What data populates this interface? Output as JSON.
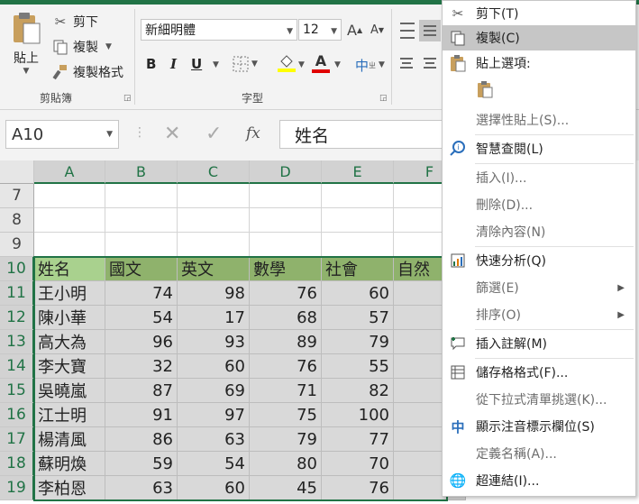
{
  "ribbon": {
    "clipboard_group": "剪貼簿",
    "font_group": "字型",
    "paste_label": "貼上",
    "cut_label": "剪下",
    "copy_label": "複製",
    "format_painter_label": "複製格式",
    "font_name": "新細明體",
    "font_size": "12",
    "bold": "B",
    "italic": "I",
    "underline": "U",
    "phonetic": "中",
    "increase_font": "A",
    "decrease_font": "A",
    "font_color": "A",
    "accent_color": "#217346"
  },
  "formula_bar": {
    "name_box": "A10",
    "fx": "fx",
    "content": "姓名"
  },
  "sheet": {
    "columns": [
      "A",
      "B",
      "C",
      "D",
      "E",
      "F"
    ],
    "rows": [
      {
        "num": "7",
        "cells": [
          "",
          "",
          "",
          "",
          "",
          ""
        ]
      },
      {
        "num": "8",
        "cells": [
          "",
          "",
          "",
          "",
          "",
          ""
        ]
      },
      {
        "num": "9",
        "cells": [
          "",
          "",
          "",
          "",
          "",
          ""
        ]
      },
      {
        "num": "10",
        "cells": [
          "姓名",
          "國文",
          "英文",
          "數學",
          "社會",
          "自然"
        ]
      },
      {
        "num": "11",
        "cells": [
          "王小明",
          "74",
          "98",
          "76",
          "60",
          ""
        ]
      },
      {
        "num": "12",
        "cells": [
          "陳小華",
          "54",
          "17",
          "68",
          "57",
          ""
        ]
      },
      {
        "num": "13",
        "cells": [
          "高大為",
          "96",
          "93",
          "89",
          "79",
          ""
        ]
      },
      {
        "num": "14",
        "cells": [
          "李大寶",
          "32",
          "60",
          "76",
          "55",
          ""
        ]
      },
      {
        "num": "15",
        "cells": [
          "吳曉嵐",
          "87",
          "69",
          "71",
          "82",
          ""
        ]
      },
      {
        "num": "16",
        "cells": [
          "江士明",
          "91",
          "97",
          "75",
          "100",
          ""
        ]
      },
      {
        "num": "17",
        "cells": [
          "楊清風",
          "86",
          "63",
          "79",
          "77",
          ""
        ]
      },
      {
        "num": "18",
        "cells": [
          "蘇明煥",
          "59",
          "54",
          "80",
          "70",
          ""
        ]
      },
      {
        "num": "19",
        "cells": [
          "李柏恩",
          "63",
          "60",
          "45",
          "76",
          ""
        ]
      }
    ],
    "header_fill": "#8fb26c",
    "active_fill": "#a9d18e",
    "selection_fill": "#d9d9d9"
  },
  "context_menu": {
    "items": [
      {
        "label": "剪下(T)",
        "icon": "scissors-icon"
      },
      {
        "label": "複製(C)",
        "icon": "copy-icon",
        "highlight": true
      },
      {
        "label": "貼上選項:",
        "icon": "paste-icon",
        "bold": true
      },
      {
        "label": "",
        "icon": "paste-icon"
      },
      {
        "label": "選擇性貼上(S)...",
        "icon": ""
      },
      {
        "label": "智慧查閱(L)",
        "icon": "search-info-icon"
      },
      {
        "label": "插入(I)...",
        "icon": ""
      },
      {
        "label": "刪除(D)...",
        "icon": ""
      },
      {
        "label": "清除內容(N)",
        "icon": ""
      },
      {
        "label": "快速分析(Q)",
        "icon": "quick-analysis-icon"
      },
      {
        "label": "篩選(E)",
        "icon": "",
        "submenu": true
      },
      {
        "label": "排序(O)",
        "icon": "",
        "submenu": true
      },
      {
        "label": "插入註解(M)",
        "icon": "comment-icon"
      },
      {
        "label": "儲存格格式(F)...",
        "icon": "format-cells-icon"
      },
      {
        "label": "從下拉式清單挑選(K)...",
        "icon": ""
      },
      {
        "label": "顯示注音標示欄位(S)",
        "icon": "phonetic-icon"
      },
      {
        "label": "定義名稱(A)...",
        "icon": ""
      },
      {
        "label": "超連結(I)...",
        "icon": "hyperlink-icon"
      }
    ]
  }
}
